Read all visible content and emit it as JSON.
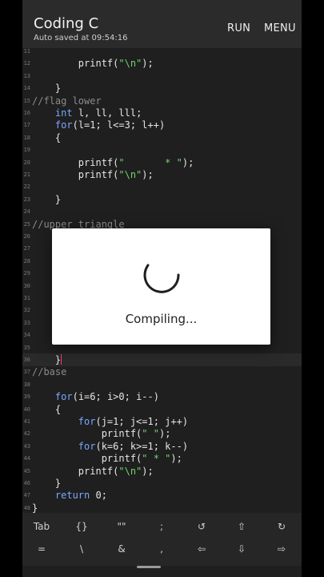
{
  "app": {
    "title": "Coding C",
    "autosave": "Auto saved at 09:54:16",
    "actions": {
      "run": "RUN",
      "menu": "MENU"
    }
  },
  "editor": {
    "lines": [
      {
        "n": "11",
        "indent": "                "
      },
      {
        "n": "12",
        "indent": "        ",
        "fn": "printf(",
        "str": "\"\\n\"",
        "tail": ");"
      },
      {
        "n": "13"
      },
      {
        "n": "14",
        "indent": "    ",
        "tail": "}"
      },
      {
        "n": "15",
        "comment": "//flag lower"
      },
      {
        "n": "16",
        "indent": "    ",
        "kw": "int",
        "tail": " l, ll, lll;"
      },
      {
        "n": "17",
        "indent": "    ",
        "kw": "for",
        "tail": "(l=1; l<=3; l++)"
      },
      {
        "n": "18",
        "indent": "    ",
        "tail": "{"
      },
      {
        "n": "19"
      },
      {
        "n": "20",
        "indent": "        ",
        "fn": "printf(",
        "str": "\"       * \"",
        "tail": ");"
      },
      {
        "n": "21",
        "indent": "        ",
        "fn": "printf(",
        "str": "\"\\n\"",
        "tail": ");"
      },
      {
        "n": "22"
      },
      {
        "n": "23",
        "indent": "    ",
        "tail": "}"
      },
      {
        "n": "24"
      },
      {
        "n": "25",
        "comment": "//upper triangle"
      },
      {
        "n": "26"
      },
      {
        "n": "27"
      },
      {
        "n": "28"
      },
      {
        "n": "29"
      },
      {
        "n": "30"
      },
      {
        "n": "31"
      },
      {
        "n": "32"
      },
      {
        "n": "33"
      },
      {
        "n": "34"
      },
      {
        "n": "35"
      },
      {
        "n": "36",
        "indent": "    ",
        "tail": "}",
        "cursor": true
      },
      {
        "n": "37",
        "comment": "//base"
      },
      {
        "n": "38"
      },
      {
        "n": "39",
        "indent": "    ",
        "kw": "for",
        "tail": "(i=6; i>0; i--)"
      },
      {
        "n": "40",
        "indent": "    ",
        "tail": "{"
      },
      {
        "n": "41",
        "indent": "        ",
        "kw": "for",
        "tail": "(j=1; j<=1; j++)"
      },
      {
        "n": "42",
        "indent": "            ",
        "fn": "printf(",
        "str": "\" \"",
        "tail": ");"
      },
      {
        "n": "43",
        "indent": "        ",
        "kw": "for",
        "tail": "(k=6; k>=1; k--)"
      },
      {
        "n": "44",
        "indent": "            ",
        "fn": "printf(",
        "str": "\" * \"",
        "tail": ");"
      },
      {
        "n": "45",
        "indent": "        ",
        "fn": "printf(",
        "str": "\"\\n\"",
        "tail": ");"
      },
      {
        "n": "46",
        "indent": "    ",
        "tail": "}"
      },
      {
        "n": "47",
        "indent": "    ",
        "kw": "return",
        "tail": " 0;"
      },
      {
        "n": "48",
        "tail": "}"
      }
    ]
  },
  "dialog": {
    "text": "Compiling..."
  },
  "symbols": {
    "row1": [
      "Tab",
      "{}",
      "\"\"",
      ";",
      "↺",
      "⇧",
      "↻"
    ],
    "row2": [
      "=",
      "\\",
      "&",
      ",",
      "⇦",
      "⇩",
      "⇨"
    ]
  },
  "colors": {
    "keyword": "#7aa6ff",
    "string": "#6fd46f",
    "comment": "#8c8c8c",
    "cursor": "#ff3b6b"
  }
}
